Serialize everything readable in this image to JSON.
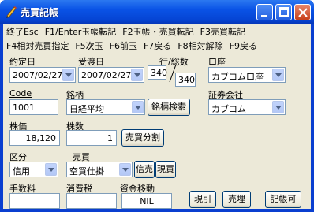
{
  "window": {
    "title": "売買記帳"
  },
  "menu_row1": [
    "終了Esc",
    "F1/Enter玉帳転記",
    "F2玉帳・売買転記",
    "F3売買転記"
  ],
  "menu_row2": [
    "F4相対売買指定",
    "F5次玉",
    "F6前玉",
    "F7戻る",
    "F8相対解除",
    "F9戻る"
  ],
  "fields": {
    "contract_date": {
      "label": "約定日",
      "value": "2007/02/27"
    },
    "delivery_date": {
      "label": "受渡日",
      "value": "2007/02/27"
    },
    "row_total": {
      "label": "行/総数",
      "row": "340",
      "total": "340"
    },
    "account": {
      "label": "口座",
      "value": "カブコム口座"
    },
    "code": {
      "label": "Code",
      "value": "1001"
    },
    "brand": {
      "label": "銘柄",
      "value": "日経平均"
    },
    "brand_search": "銘柄検索",
    "broker": {
      "label": "証券会社",
      "value": "カブコム"
    },
    "price": {
      "label": "株価",
      "value": "18,120"
    },
    "quantity": {
      "label": "株数",
      "value": "1"
    },
    "split_button": "売買分割",
    "category": {
      "label": "区分",
      "value": "信用"
    },
    "trade": {
      "label": "売買",
      "value": "空買仕掛"
    },
    "credit_sell_button": "信売",
    "buy_button": "現買",
    "commission": {
      "label": "手数料",
      "value": ""
    },
    "tax": {
      "label": "消費税",
      "value": ""
    },
    "fund_transfer": {
      "label": "資金移動",
      "value": "NIL"
    }
  },
  "buttons": {
    "genbiki": "現引",
    "genwatashi": "売埋",
    "ledger_ok": "記帳可"
  },
  "colors": {
    "title_bar": "#0a53e6",
    "client_bg": "#ece9d8",
    "field_border": "#7f9db9"
  }
}
